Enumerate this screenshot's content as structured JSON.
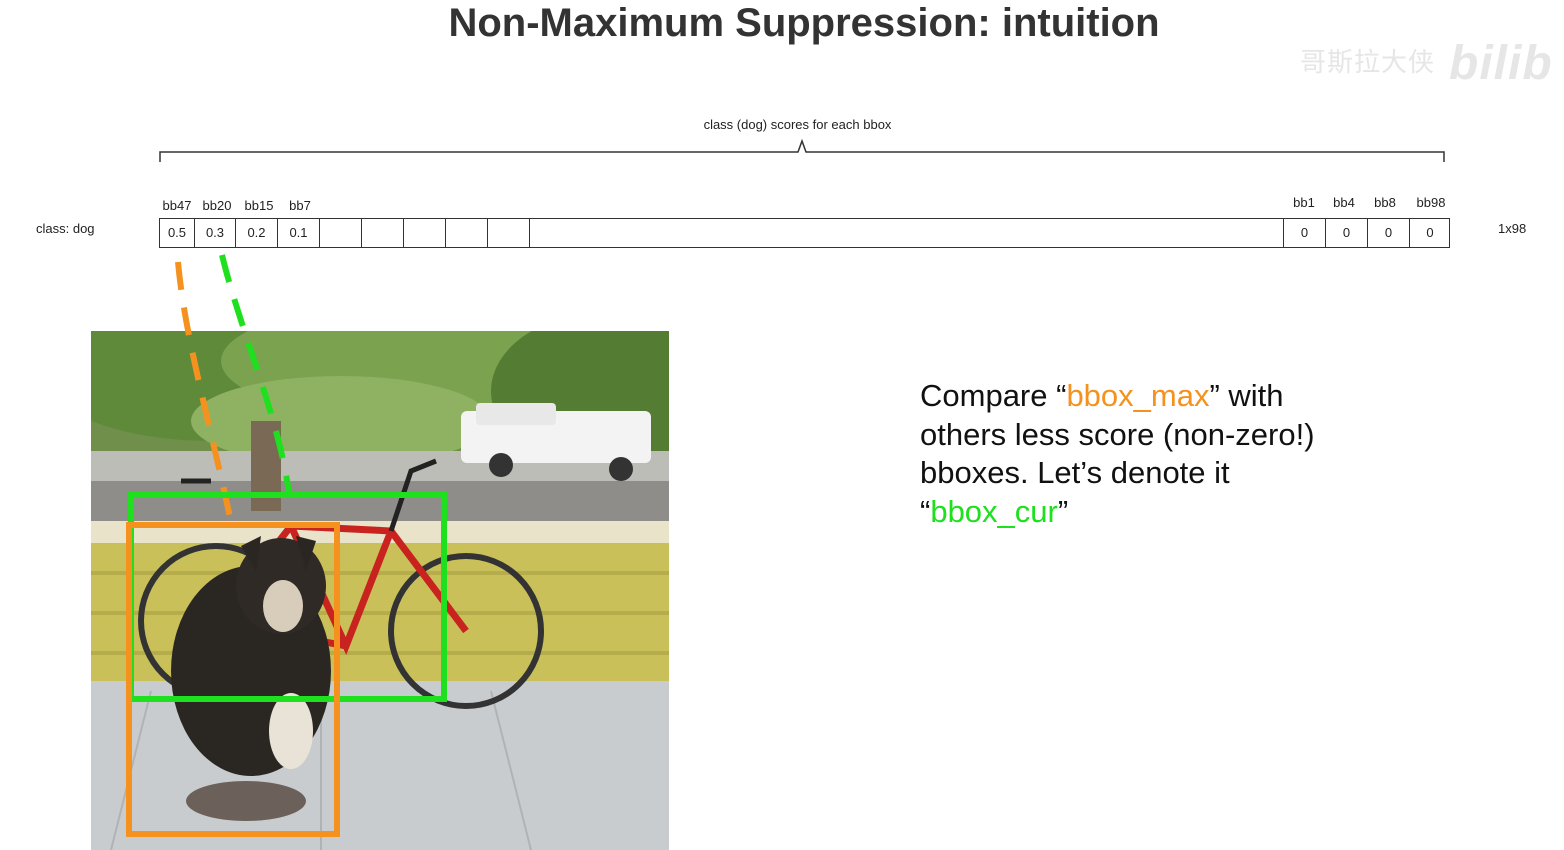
{
  "title": "Non-Maximum Suppression: intuition",
  "watermark": {
    "text": "哥斯拉大侠",
    "logo": "bilib"
  },
  "brace_label": "class (dog) scores for each bbox",
  "class_label": "class: dog",
  "vector_dims": "1x98",
  "cells": [
    {
      "header": "bb47",
      "score": "0.5"
    },
    {
      "header": "bb20",
      "score": "0.3"
    },
    {
      "header": "bb15",
      "score": "0.2"
    },
    {
      "header": "bb7",
      "score": "0.1"
    },
    {
      "header": "",
      "score": ""
    },
    {
      "header": "",
      "score": ""
    },
    {
      "header": "",
      "score": ""
    },
    {
      "header": "",
      "score": ""
    },
    {
      "header": "",
      "score": ""
    },
    {
      "header": "",
      "score": ""
    },
    {
      "header": "bb1",
      "score": "0"
    },
    {
      "header": "bb4",
      "score": "0"
    },
    {
      "header": "bb8",
      "score": "0"
    },
    {
      "header": "bb98",
      "score": "0"
    }
  ],
  "caption": {
    "line1_pre": "Compare “",
    "bbox_max": "bbox_max",
    "line1_post": "” with",
    "line2": "others less score (non-zero!)",
    "line3": "bboxes. Let’s denote it",
    "line4_pre": "“",
    "bbox_cur": "bbox_cur",
    "line4_post": "”"
  },
  "colors": {
    "bbox_max": "#f5921f",
    "bbox_cur": "#1fe01f"
  }
}
